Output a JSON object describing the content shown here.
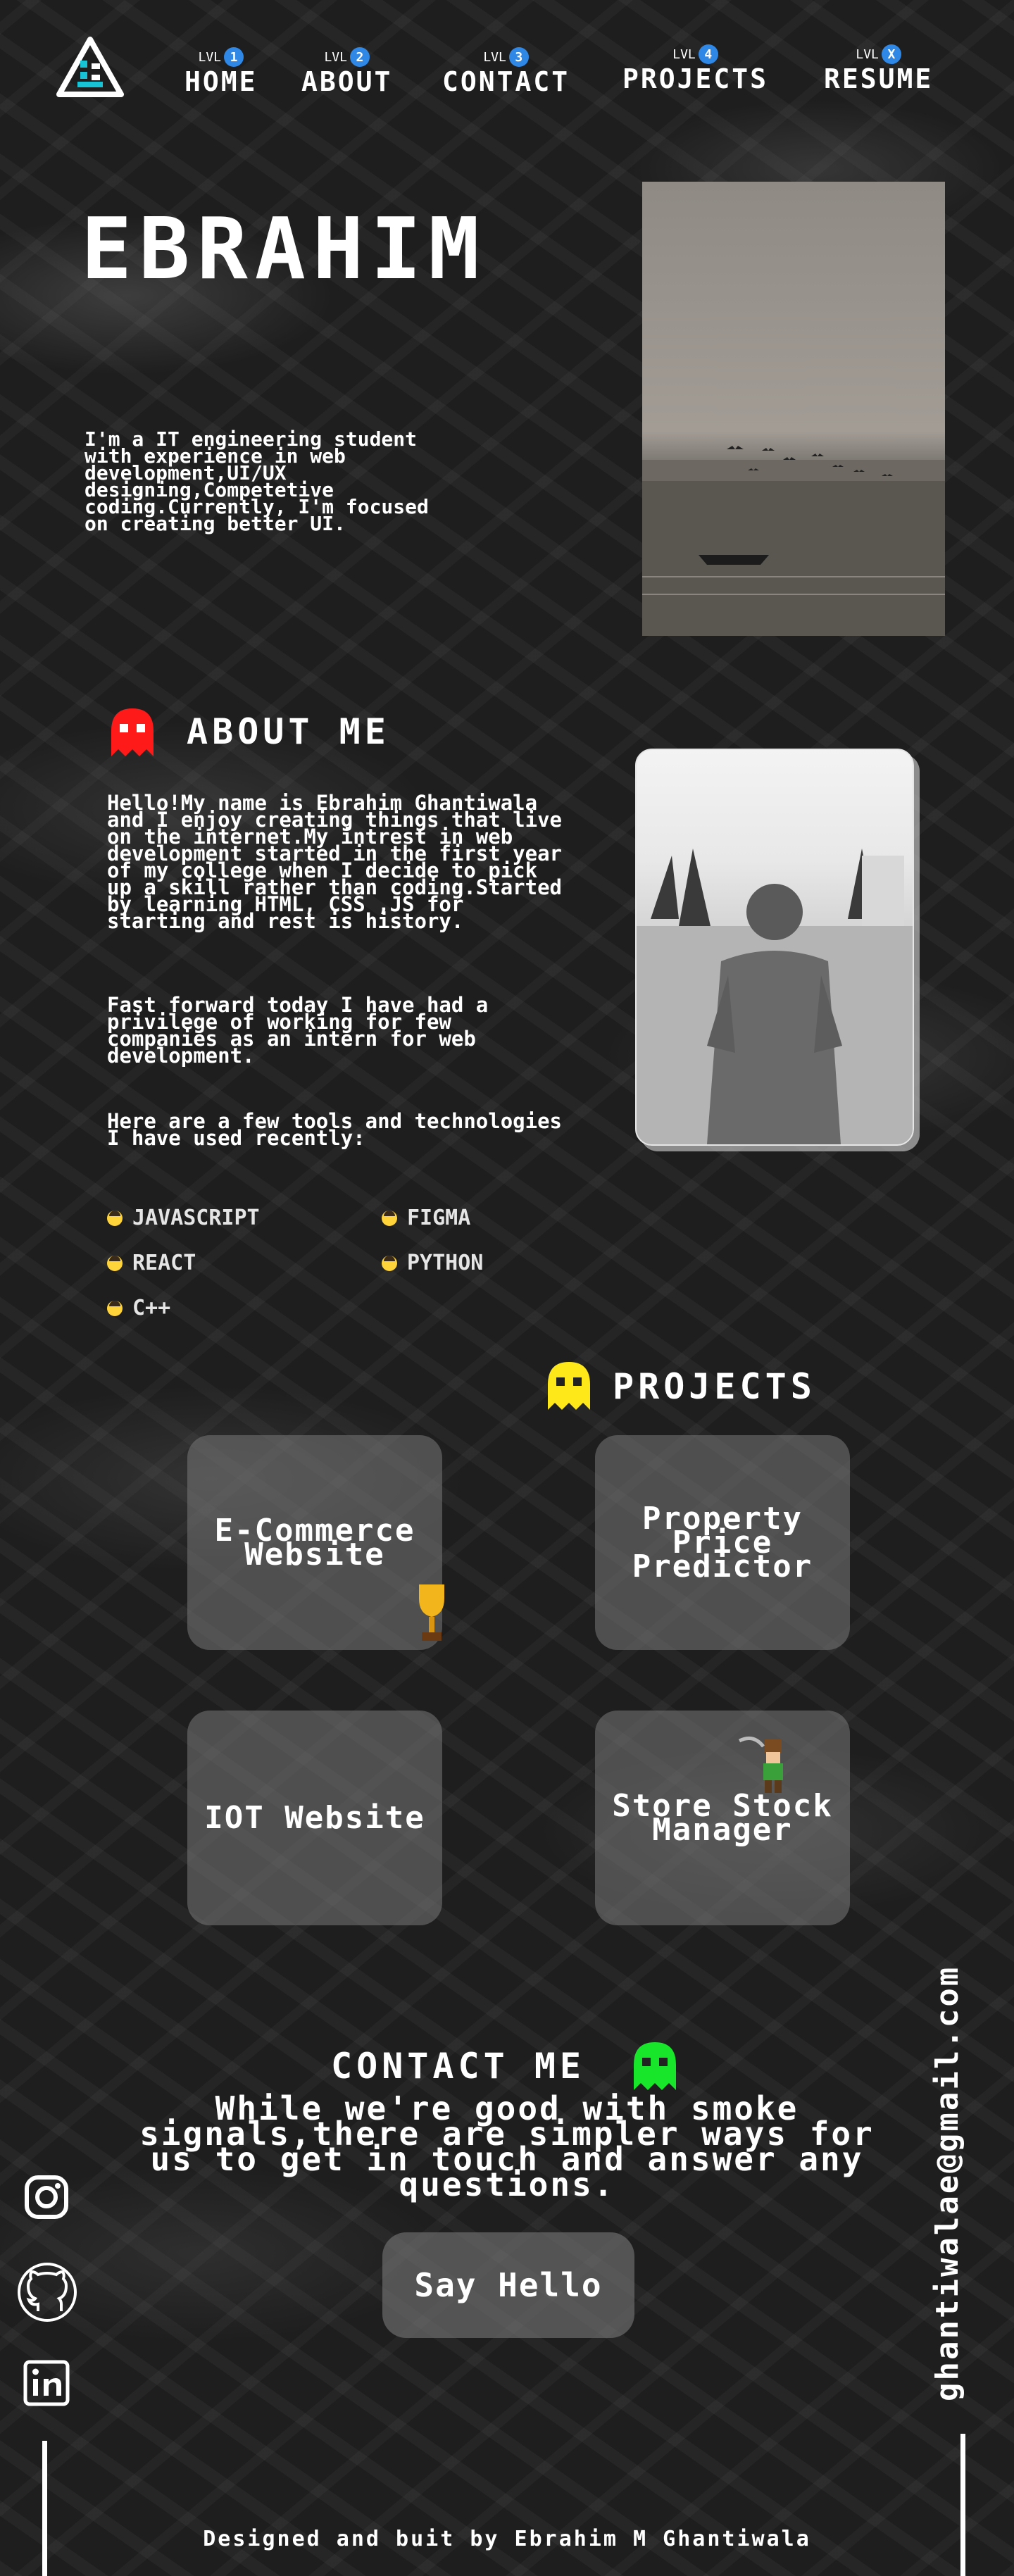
{
  "nav": {
    "lvl_prefix": "LVL",
    "items": [
      {
        "badge": "1",
        "label": "HOME"
      },
      {
        "badge": "2",
        "label": "ABOUT"
      },
      {
        "badge": "3",
        "label": "CONTACT"
      },
      {
        "badge": "4",
        "label": "PROJECTS"
      },
      {
        "badge": "X",
        "label": "RESUME"
      }
    ]
  },
  "hero": {
    "name": "EBRAHIM",
    "description": "I'm a IT engineering student with experience in web development,UI/UX designing,Competetive coding.Currently, I'm focused on creating better UI."
  },
  "about": {
    "title": "ABOUT ME",
    "para1": "Hello!My name is Ebrahim Ghantiwala and I enjoy creating things that live on the internet.My intrest in web development started in the first year of my college when I decide to pick up a skill rather than coding.Started by learning HTML, CSS ,JS for starting and rest is history.",
    "para2": "Fast forward today I have had a privilege of working for few companies as an intern for web development.",
    "para3": "Here are a few tools and technologies I have used recently:",
    "skills": [
      "JAVASCRIPT",
      "FIGMA",
      "REACT",
      "PYTHON",
      "C++"
    ]
  },
  "projects": {
    "title": "PROJECTS",
    "items": [
      "E-Commerce Website",
      "Property Price Predictor",
      "IOT Website",
      "Store Stock Manager"
    ]
  },
  "contact": {
    "title": "CONTACT ME",
    "text": "While we're good with smoke signals,there are simpler ways for us to get in touch and answer any questions.",
    "button": "Say Hello",
    "email": "ghantiwalae@gmail.com"
  },
  "social": [
    "instagram-icon",
    "github-icon",
    "linkedin-icon"
  ],
  "footer": "Designed and buit by Ebrahim M Ghantiwala",
  "colors": {
    "badge": "#2f87e6",
    "ghost_red": "#ff1a1a",
    "ghost_yellow": "#ffe81a",
    "ghost_green": "#17e62a"
  }
}
